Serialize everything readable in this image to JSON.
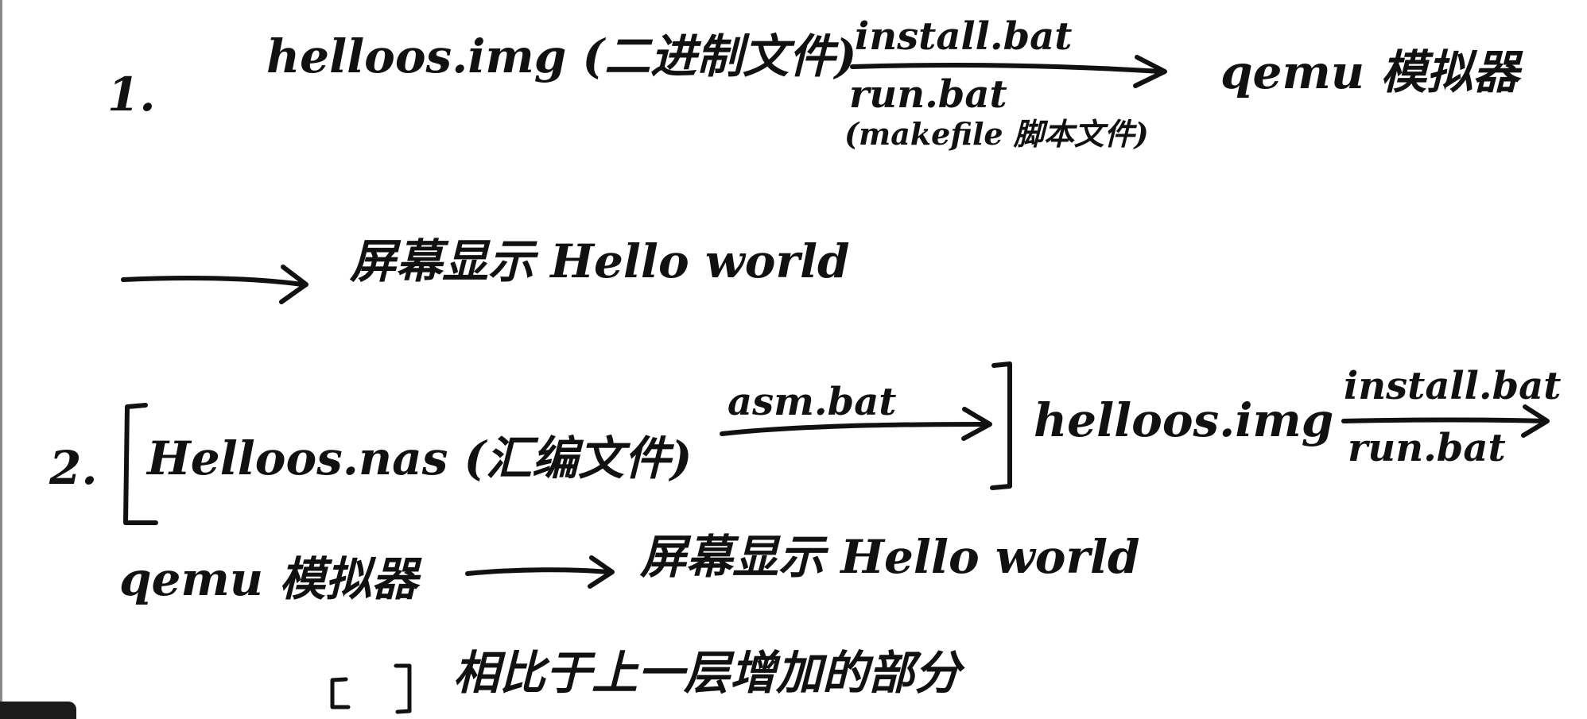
{
  "line1": {
    "number": "1.",
    "source": "helloos.img (二进制文件)",
    "arrow_top": "install.bat",
    "arrow_bottom": "run.bat",
    "arrow_note": "(makefile 脚本文件)",
    "target": "qemu 模拟器"
  },
  "line1_result": {
    "text": "屏幕显示 Hello world"
  },
  "line2": {
    "number": "2.",
    "source": "Helloos.nas (汇编文件)",
    "arrow1_top": "asm.bat",
    "middle": "helloos.img",
    "arrow2_top": "install.bat",
    "arrow2_bottom": "run.bat"
  },
  "line2_result": {
    "emulator": "qemu 模拟器",
    "text": "屏幕显示 Hello world"
  },
  "legend": {
    "text": "相比于上一层增加的部分"
  },
  "colors": {
    "ink": "#111111",
    "paper": "#ffffff"
  }
}
